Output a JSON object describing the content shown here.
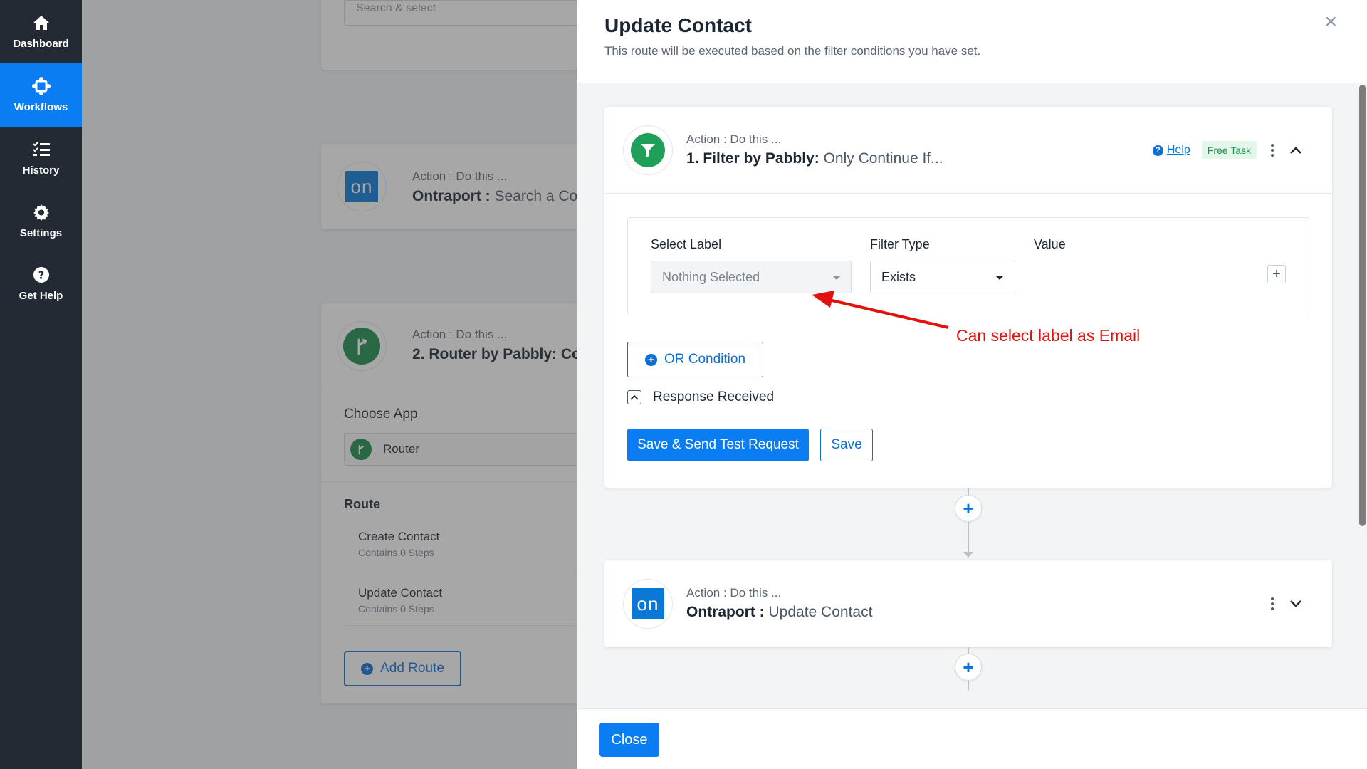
{
  "sidebar": {
    "items": [
      {
        "label": "Dashboard",
        "icon": "home-icon"
      },
      {
        "label": "Workflows",
        "icon": "workflow-icon",
        "active": true
      },
      {
        "label": "History",
        "icon": "list-icon"
      },
      {
        "label": "Settings",
        "icon": "gear-icon"
      },
      {
        "label": "Get Help",
        "icon": "question-icon"
      }
    ]
  },
  "background": {
    "search_placeholder": "Search & select",
    "ontraport_step": {
      "subtitle": "Action : Do this ...",
      "app": "Ontraport :",
      "action": "Search a Cont",
      "logo_text": "on"
    },
    "router_step": {
      "subtitle": "Action : Do this ...",
      "title": "2. Router by Pabbly: Co",
      "choose_app_label": "Choose App",
      "selected_app": "Router",
      "route_label": "Route",
      "routes": [
        {
          "name": "Create Contact",
          "steps": "Contains 0 Steps"
        },
        {
          "name": "Update Contact",
          "steps": "Contains 0 Steps"
        }
      ],
      "add_route_label": "Add Route"
    }
  },
  "panel": {
    "title": "Update Contact",
    "subtitle": "This route will be executed based on the filter conditions you have set.",
    "close_label": "Close",
    "filter_step": {
      "subtitle": "Action : Do this ...",
      "title": "1. Filter by Pabbly:",
      "action": "Only Continue If...",
      "help_label": "Help",
      "badge": "Free Task",
      "select_label_header": "Select Label",
      "filter_type_header": "Filter Type",
      "value_header": "Value",
      "select_label_value": "Nothing Selected",
      "filter_type_value": "Exists",
      "or_condition_label": "OR Condition",
      "response_label": "Response Received",
      "save_send_label": "Save & Send Test Request",
      "save_label": "Save"
    },
    "ontraport_step": {
      "subtitle": "Action : Do this ...",
      "app": "Ontraport :",
      "action": "Update Contact",
      "logo_text": "on"
    }
  },
  "annotation": {
    "text": "Can select label as Email",
    "color": "#e0110f"
  },
  "colors": {
    "accent": "#0a7df2",
    "sidebar_bg": "#232a33",
    "filter_green": "#1fa05a",
    "router_green": "#1b8a4e",
    "ontraport_blue": "#0a78d7"
  }
}
